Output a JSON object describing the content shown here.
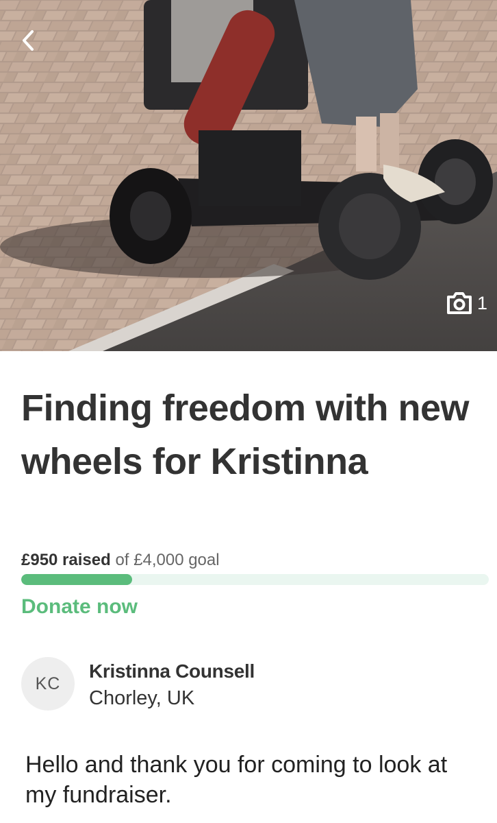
{
  "hero": {
    "photo_count": "1",
    "icons": {
      "back": "chevron-left-icon",
      "camera": "camera-icon"
    }
  },
  "campaign": {
    "title": "Finding freedom with new wheels for Kristinna",
    "raised_amount": "£950 raised",
    "goal_text": "of £4,000 goal",
    "progress_fraction": 0.2375,
    "donate_label": "Donate now"
  },
  "organizer": {
    "initials": "KC",
    "name": "Kristinna Counsell",
    "location": "Chorley, UK"
  },
  "story": {
    "intro": "Hello and thank you for coming to look at my fundraiser."
  },
  "colors": {
    "accent": "#5bbc7c",
    "progress_track": "#eaf6f0",
    "text": "#333333"
  }
}
